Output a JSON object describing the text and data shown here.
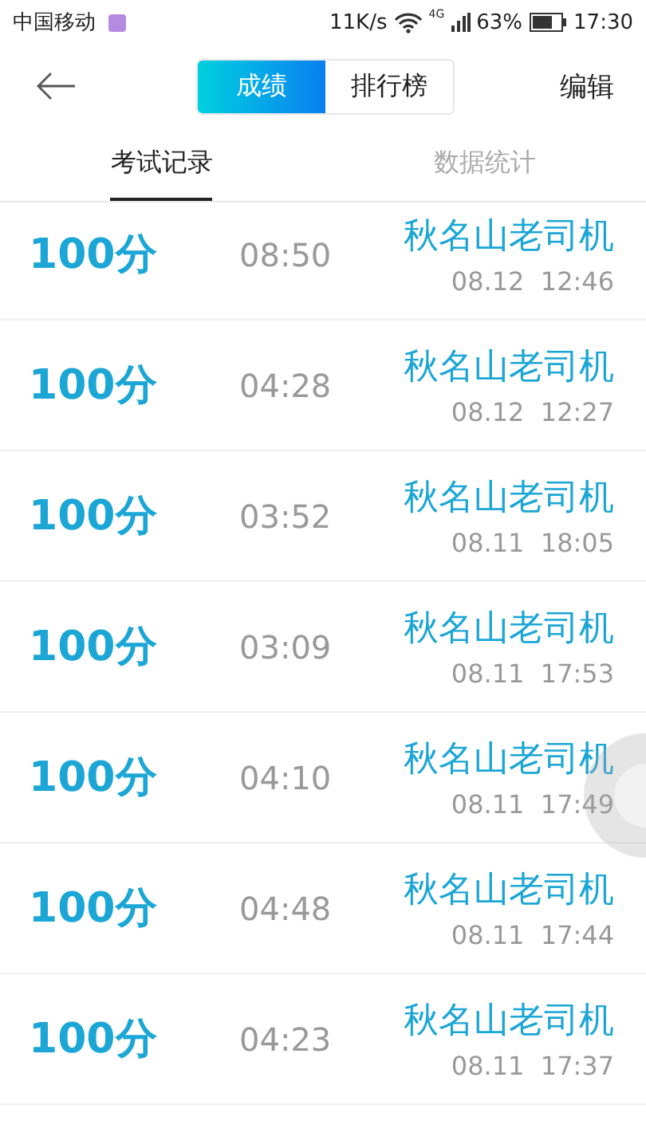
{
  "status_bar": {
    "carrier": "中国移动",
    "speed": "11K/s",
    "network": "4G",
    "battery": "63%",
    "time": "17:30"
  },
  "header": {
    "segments": [
      {
        "label": "成绩",
        "selected": true
      },
      {
        "label": "排行榜",
        "selected": false
      }
    ],
    "action": "编辑"
  },
  "tabs": [
    {
      "label": "考试记录",
      "selected": true
    },
    {
      "label": "数据统计",
      "selected": false
    }
  ],
  "records": [
    {
      "score": "100分",
      "duration": "08:50",
      "name": "秋名山老司机",
      "date": "08.12",
      "time": "12:46"
    },
    {
      "score": "100分",
      "duration": "04:28",
      "name": "秋名山老司机",
      "date": "08.12",
      "time": "12:27"
    },
    {
      "score": "100分",
      "duration": "03:52",
      "name": "秋名山老司机",
      "date": "08.11",
      "time": "18:05"
    },
    {
      "score": "100分",
      "duration": "03:09",
      "name": "秋名山老司机",
      "date": "08.11",
      "time": "17:53"
    },
    {
      "score": "100分",
      "duration": "04:10",
      "name": "秋名山老司机",
      "date": "08.11",
      "time": "17:49"
    },
    {
      "score": "100分",
      "duration": "04:48",
      "name": "秋名山老司机",
      "date": "08.11",
      "time": "17:44"
    },
    {
      "score": "100分",
      "duration": "04:23",
      "name": "秋名山老司机",
      "date": "08.11",
      "time": "17:37"
    }
  ]
}
